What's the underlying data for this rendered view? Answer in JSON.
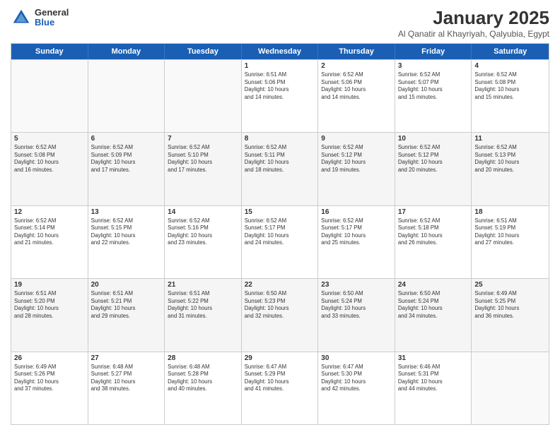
{
  "logo": {
    "general": "General",
    "blue": "Blue"
  },
  "title": "January 2025",
  "subtitle": "Al Qanatir al Khayriyah, Qalyubia, Egypt",
  "headers": [
    "Sunday",
    "Monday",
    "Tuesday",
    "Wednesday",
    "Thursday",
    "Friday",
    "Saturday"
  ],
  "rows": [
    [
      {
        "day": "",
        "info": ""
      },
      {
        "day": "",
        "info": ""
      },
      {
        "day": "",
        "info": ""
      },
      {
        "day": "1",
        "info": "Sunrise: 6:51 AM\nSunset: 5:06 PM\nDaylight: 10 hours\nand 14 minutes."
      },
      {
        "day": "2",
        "info": "Sunrise: 6:52 AM\nSunset: 5:06 PM\nDaylight: 10 hours\nand 14 minutes."
      },
      {
        "day": "3",
        "info": "Sunrise: 6:52 AM\nSunset: 5:07 PM\nDaylight: 10 hours\nand 15 minutes."
      },
      {
        "day": "4",
        "info": "Sunrise: 6:52 AM\nSunset: 5:08 PM\nDaylight: 10 hours\nand 15 minutes."
      }
    ],
    [
      {
        "day": "5",
        "info": "Sunrise: 6:52 AM\nSunset: 5:08 PM\nDaylight: 10 hours\nand 16 minutes."
      },
      {
        "day": "6",
        "info": "Sunrise: 6:52 AM\nSunset: 5:09 PM\nDaylight: 10 hours\nand 17 minutes."
      },
      {
        "day": "7",
        "info": "Sunrise: 6:52 AM\nSunset: 5:10 PM\nDaylight: 10 hours\nand 17 minutes."
      },
      {
        "day": "8",
        "info": "Sunrise: 6:52 AM\nSunset: 5:11 PM\nDaylight: 10 hours\nand 18 minutes."
      },
      {
        "day": "9",
        "info": "Sunrise: 6:52 AM\nSunset: 5:12 PM\nDaylight: 10 hours\nand 19 minutes."
      },
      {
        "day": "10",
        "info": "Sunrise: 6:52 AM\nSunset: 5:12 PM\nDaylight: 10 hours\nand 20 minutes."
      },
      {
        "day": "11",
        "info": "Sunrise: 6:52 AM\nSunset: 5:13 PM\nDaylight: 10 hours\nand 20 minutes."
      }
    ],
    [
      {
        "day": "12",
        "info": "Sunrise: 6:52 AM\nSunset: 5:14 PM\nDaylight: 10 hours\nand 21 minutes."
      },
      {
        "day": "13",
        "info": "Sunrise: 6:52 AM\nSunset: 5:15 PM\nDaylight: 10 hours\nand 22 minutes."
      },
      {
        "day": "14",
        "info": "Sunrise: 6:52 AM\nSunset: 5:16 PM\nDaylight: 10 hours\nand 23 minutes."
      },
      {
        "day": "15",
        "info": "Sunrise: 6:52 AM\nSunset: 5:17 PM\nDaylight: 10 hours\nand 24 minutes."
      },
      {
        "day": "16",
        "info": "Sunrise: 6:52 AM\nSunset: 5:17 PM\nDaylight: 10 hours\nand 25 minutes."
      },
      {
        "day": "17",
        "info": "Sunrise: 6:52 AM\nSunset: 5:18 PM\nDaylight: 10 hours\nand 26 minutes."
      },
      {
        "day": "18",
        "info": "Sunrise: 6:51 AM\nSunset: 5:19 PM\nDaylight: 10 hours\nand 27 minutes."
      }
    ],
    [
      {
        "day": "19",
        "info": "Sunrise: 6:51 AM\nSunset: 5:20 PM\nDaylight: 10 hours\nand 28 minutes."
      },
      {
        "day": "20",
        "info": "Sunrise: 6:51 AM\nSunset: 5:21 PM\nDaylight: 10 hours\nand 29 minutes."
      },
      {
        "day": "21",
        "info": "Sunrise: 6:51 AM\nSunset: 5:22 PM\nDaylight: 10 hours\nand 31 minutes."
      },
      {
        "day": "22",
        "info": "Sunrise: 6:50 AM\nSunset: 5:23 PM\nDaylight: 10 hours\nand 32 minutes."
      },
      {
        "day": "23",
        "info": "Sunrise: 6:50 AM\nSunset: 5:24 PM\nDaylight: 10 hours\nand 33 minutes."
      },
      {
        "day": "24",
        "info": "Sunrise: 6:50 AM\nSunset: 5:24 PM\nDaylight: 10 hours\nand 34 minutes."
      },
      {
        "day": "25",
        "info": "Sunrise: 6:49 AM\nSunset: 5:25 PM\nDaylight: 10 hours\nand 36 minutes."
      }
    ],
    [
      {
        "day": "26",
        "info": "Sunrise: 6:49 AM\nSunset: 5:26 PM\nDaylight: 10 hours\nand 37 minutes."
      },
      {
        "day": "27",
        "info": "Sunrise: 6:48 AM\nSunset: 5:27 PM\nDaylight: 10 hours\nand 38 minutes."
      },
      {
        "day": "28",
        "info": "Sunrise: 6:48 AM\nSunset: 5:28 PM\nDaylight: 10 hours\nand 40 minutes."
      },
      {
        "day": "29",
        "info": "Sunrise: 6:47 AM\nSunset: 5:29 PM\nDaylight: 10 hours\nand 41 minutes."
      },
      {
        "day": "30",
        "info": "Sunrise: 6:47 AM\nSunset: 5:30 PM\nDaylight: 10 hours\nand 42 minutes."
      },
      {
        "day": "31",
        "info": "Sunrise: 6:46 AM\nSunset: 5:31 PM\nDaylight: 10 hours\nand 44 minutes."
      },
      {
        "day": "",
        "info": ""
      }
    ]
  ]
}
